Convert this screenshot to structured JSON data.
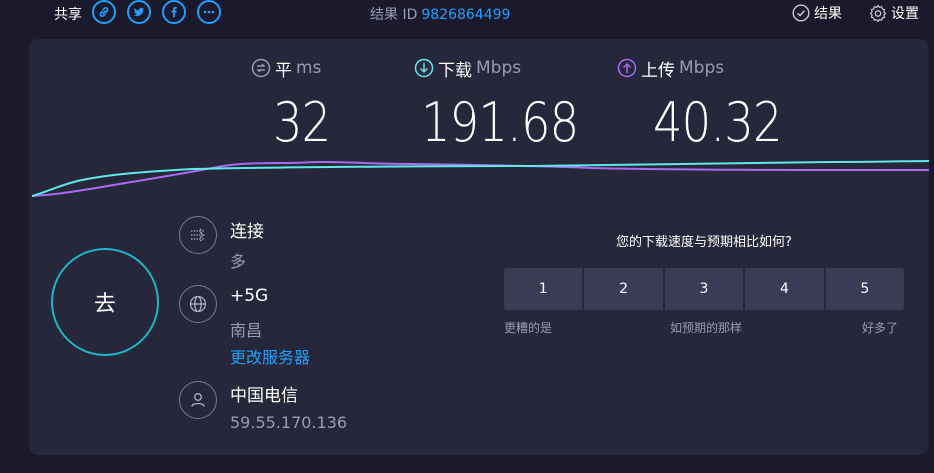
{
  "topbar": {
    "share_label": "共享",
    "social_icons": [
      "link-icon",
      "twitter-icon",
      "facebook-icon",
      "more-icon"
    ],
    "result_id_label": "结果 ID",
    "result_id": "9826864499",
    "results_label": "结果",
    "settings_label": "设置"
  },
  "metrics": {
    "ping": {
      "name": "平",
      "unit": "ms",
      "value": "32"
    },
    "download": {
      "name": "下载",
      "unit": "Mbps",
      "value": "191.68"
    },
    "upload": {
      "name": "上传",
      "unit": "Mbps",
      "value": "40.32"
    }
  },
  "colors": {
    "accent": "#1ea0ff",
    "download": "#5ee8e8",
    "upload": "#a56cf0",
    "go_ring": "#1bb7c4",
    "background": "#1a1a2c",
    "card": "#26273b"
  },
  "go_button": {
    "label": "去"
  },
  "connection": {
    "connections": {
      "title": "连接",
      "value": "多"
    },
    "server": {
      "title": "+5G",
      "location": "南昌",
      "change_link": "更改服务器"
    },
    "provider": {
      "name": "中国电信",
      "ip": "59.55.170.136"
    }
  },
  "survey": {
    "question": "您的下载速度与预期相比如何?",
    "options": [
      "1",
      "2",
      "3",
      "4",
      "5"
    ],
    "low_label": "更糟的是",
    "mid_label": "如预期的那样",
    "high_label": "好多了"
  }
}
